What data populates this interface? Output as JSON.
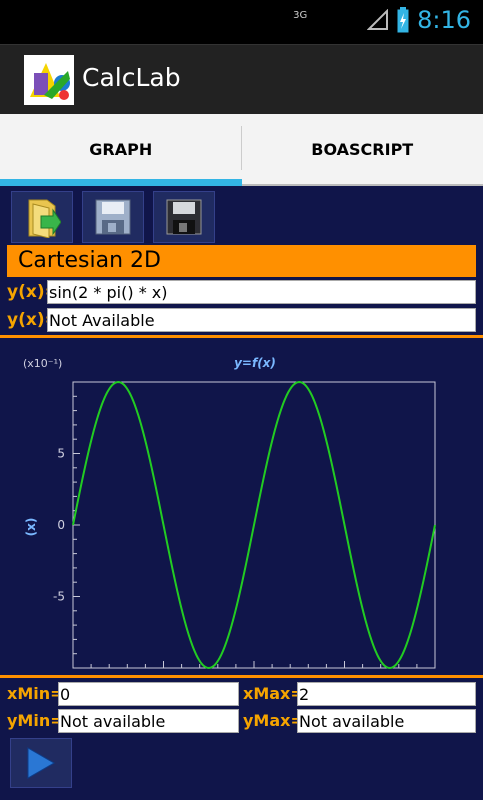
{
  "status": {
    "network": "3G",
    "time": "8:16"
  },
  "app": {
    "title": "CalcLab"
  },
  "tabs": [
    {
      "label": "GRAPH",
      "active": true
    },
    {
      "label": "BOASCRIPT",
      "active": false
    }
  ],
  "toolbar": [
    "open-folder-icon",
    "save-icon",
    "save-as-icon"
  ],
  "section_title": "Cartesian 2D",
  "functions": [
    {
      "label": "y(x)=",
      "value": "sin(2 * pi() * x)"
    },
    {
      "label": "y(x)=",
      "value": "Not Available"
    }
  ],
  "chart_data": {
    "type": "line",
    "title": "y=f(x)",
    "xlabel": "",
    "ylabel": "(x)",
    "exponent": "(x10⁻¹)",
    "xlim": [
      0,
      2
    ],
    "ylim": [
      -10,
      10
    ],
    "yticks": [
      "5",
      "0",
      "-5"
    ],
    "series": [
      {
        "function": "sin(2*pi*x)",
        "color": "#22cc22"
      }
    ]
  },
  "ranges": {
    "xmin_label": "xMin=",
    "xmin": "0",
    "xmax_label": "xMax=",
    "xmax": "2",
    "ymin_label": "yMin=",
    "ymin": "Not available",
    "ymax_label": "yMax=",
    "ymax": "Not available"
  }
}
